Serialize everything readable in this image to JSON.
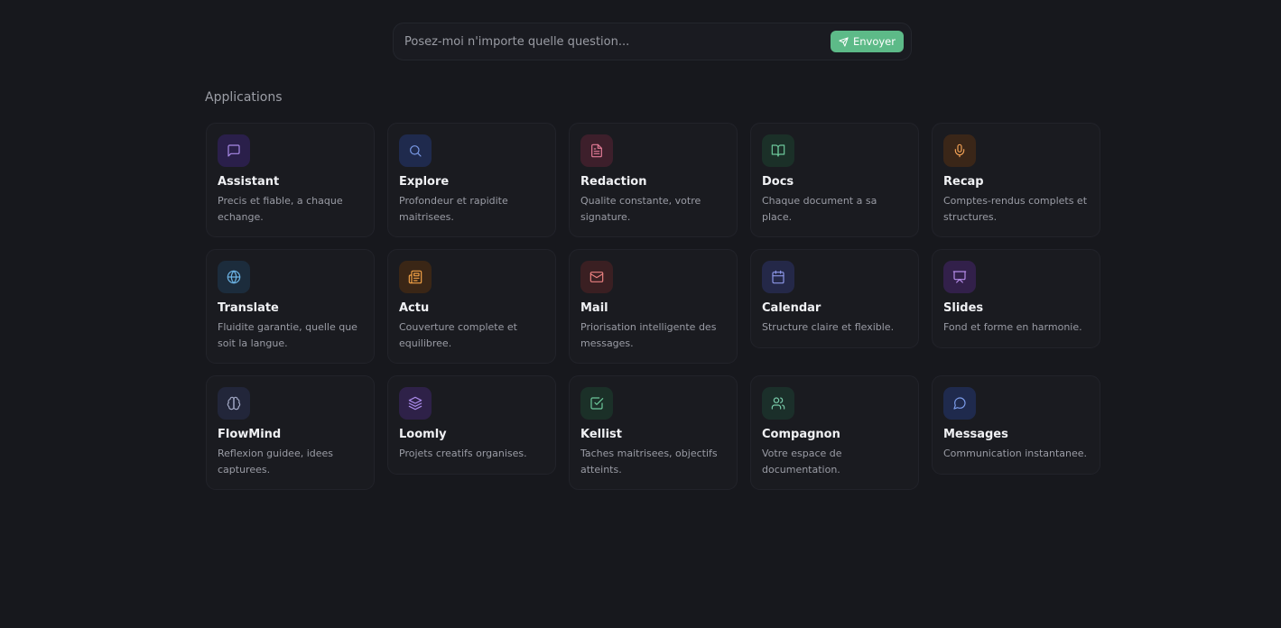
{
  "search": {
    "placeholder": "Posez-moi n'importe quelle question...",
    "value": "",
    "send_label": "Envoyer",
    "accent": "#5dba88"
  },
  "applications": {
    "title": "Applications",
    "items": [
      {
        "name": "Assistant",
        "desc": "Precis et fiable, a chaque echange.",
        "icon": "message-square-icon",
        "bg": "#2a1f4a",
        "fg": "#a98ae8"
      },
      {
        "name": "Explore",
        "desc": "Profondeur et rapidite maitrisees.",
        "icon": "search-icon",
        "bg": "#1f2a4d",
        "fg": "#7b9be8"
      },
      {
        "name": "Redaction",
        "desc": "Qualite constante, votre signature.",
        "icon": "file-text-icon",
        "bg": "#3d1f2b",
        "fg": "#e07a95"
      },
      {
        "name": "Docs",
        "desc": "Chaque document a sa place.",
        "icon": "book-open-icon",
        "bg": "#1b3028",
        "fg": "#6cc79a"
      },
      {
        "name": "Recap",
        "desc": "Comptes-rendus complets et structures.",
        "icon": "mic-icon",
        "bg": "#3a2618",
        "fg": "#f0a055"
      },
      {
        "name": "Translate",
        "desc": "Fluidite garantie, quelle que soit la langue.",
        "icon": "globe-icon",
        "bg": "#1c2c3c",
        "fg": "#6bb2e3"
      },
      {
        "name": "Actu",
        "desc": "Couverture complete et equilibree.",
        "icon": "newspaper-icon",
        "bg": "#3a2616",
        "fg": "#f0a045"
      },
      {
        "name": "Mail",
        "desc": "Priorisation intelligente des messages.",
        "icon": "mail-icon",
        "bg": "#3a1f22",
        "fg": "#e98080"
      },
      {
        "name": "Calendar",
        "desc": "Structure claire et flexible.",
        "icon": "calendar-icon",
        "bg": "#242848",
        "fg": "#8c95e6"
      },
      {
        "name": "Slides",
        "desc": "Fond et forme en harmonie.",
        "icon": "presentation-icon",
        "bg": "#32204a",
        "fg": "#b38ae6"
      },
      {
        "name": "FlowMind",
        "desc": "Reflexion guidee, idees capturees.",
        "icon": "brain-icon",
        "bg": "#22263a",
        "fg": "#a2a8c5"
      },
      {
        "name": "Loomly",
        "desc": "Projets creatifs organises.",
        "icon": "layers-icon",
        "bg": "#2e2148",
        "fg": "#a98ae8"
      },
      {
        "name": "Kellist",
        "desc": "Taches maitrisees, objectifs atteints.",
        "icon": "check-square-icon",
        "bg": "#1b3028",
        "fg": "#6cc79a"
      },
      {
        "name": "Compagnon",
        "desc": "Votre espace de documentation.",
        "icon": "users-icon",
        "bg": "#1b2f2a",
        "fg": "#78c9a8"
      },
      {
        "name": "Messages",
        "desc": "Communication instantanee.",
        "icon": "message-circle-icon",
        "bg": "#1f2a4d",
        "fg": "#7b9be8"
      }
    ]
  }
}
